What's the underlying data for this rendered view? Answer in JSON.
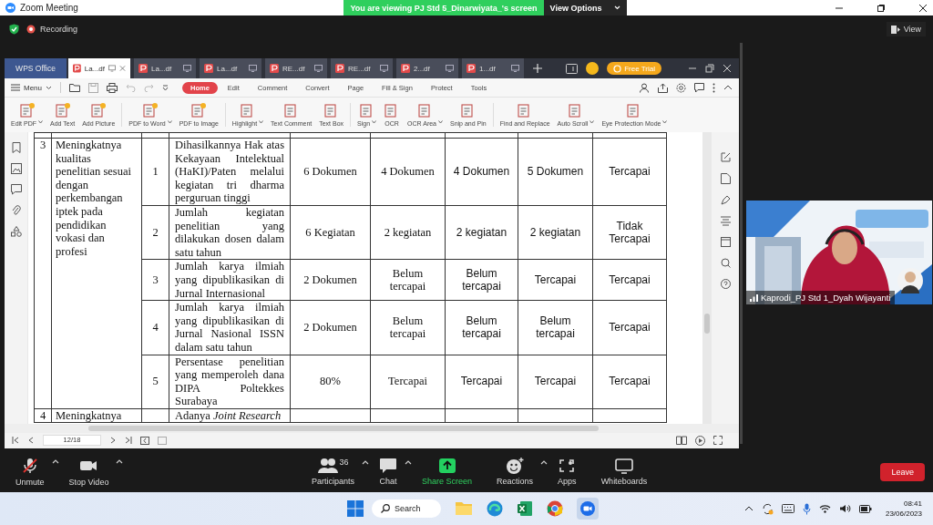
{
  "title_bar": {
    "title": "Zoom Meeting",
    "banner": "You are viewing PJ Std 5_Dinarwiyata_'s screen",
    "view_options": "View Options"
  },
  "meeting": {
    "recording": "Recording",
    "view_button": "View"
  },
  "wps": {
    "app_tab": "WPS Office",
    "tabs": [
      {
        "label": "La...df",
        "selected": true
      },
      {
        "label": "La...df",
        "selected": false
      },
      {
        "label": "La...df",
        "selected": false
      },
      {
        "label": "RE...df",
        "selected": false
      },
      {
        "label": "RE...df",
        "selected": false
      },
      {
        "label": "2...df",
        "selected": false
      },
      {
        "label": "1...df",
        "selected": false
      }
    ],
    "trial_button": "Free Trial",
    "menu": "Menu",
    "ribbon_tabs": [
      {
        "label": "Home",
        "selected": true
      },
      {
        "label": "Edit",
        "selected": false
      },
      {
        "label": "Comment",
        "selected": false
      },
      {
        "label": "Convert",
        "selected": false
      },
      {
        "label": "Page",
        "selected": false
      },
      {
        "label": "Fill & Sign",
        "selected": false
      },
      {
        "label": "Protect",
        "selected": false
      },
      {
        "label": "Tools",
        "selected": false
      }
    ],
    "tools": [
      {
        "label": "Edit PDF",
        "dropdown": true,
        "badge": true,
        "separator_before": false
      },
      {
        "label": "Add Text",
        "dropdown": false,
        "badge": true,
        "separator_before": false
      },
      {
        "label": "Add Picture",
        "dropdown": false,
        "badge": true,
        "separator_before": false
      },
      {
        "label": "PDF to Word",
        "dropdown": true,
        "badge": true,
        "separator_before": true
      },
      {
        "label": "PDF to Image",
        "dropdown": false,
        "badge": true,
        "separator_before": false
      },
      {
        "label": "Highlight",
        "dropdown": true,
        "badge": false,
        "separator_before": true
      },
      {
        "label": "Text Comment",
        "dropdown": false,
        "badge": false,
        "separator_before": false
      },
      {
        "label": "Text Box",
        "dropdown": false,
        "badge": false,
        "separator_before": false
      },
      {
        "label": "Sign",
        "dropdown": true,
        "badge": false,
        "separator_before": true
      },
      {
        "label": "OCR",
        "dropdown": false,
        "badge": false,
        "separator_before": false
      },
      {
        "label": "OCR Area",
        "dropdown": true,
        "badge": false,
        "separator_before": false
      },
      {
        "label": "Snip and Pin",
        "dropdown": false,
        "badge": false,
        "separator_before": false
      },
      {
        "label": "Find and Replace",
        "dropdown": false,
        "badge": false,
        "separator_before": true
      },
      {
        "label": "Auto Scroll",
        "dropdown": true,
        "badge": false,
        "separator_before": false
      },
      {
        "label": "Eye Protection Mode",
        "dropdown": true,
        "badge": false,
        "separator_before": false
      }
    ]
  },
  "document": {
    "goals": [
      {
        "no": "3",
        "objective": "Meningkatnya kualitas penelitian sesuai dengan perkembangan iptek pada pendidikan vokasi dan profesi",
        "items": [
          {
            "index": "1",
            "indicator": "Dihasilkannya Hak atas Kekayaan Intelektual (HaKI)/Paten melalui kegiatan tri dharma perguruan tinggi",
            "values": [
              "6 Dokumen",
              "4 Dokumen",
              "4 Dokumen",
              "5 Dokumen",
              "Tercapai"
            ]
          },
          {
            "index": "2",
            "indicator": "Jumlah kegiatan penelitian yang dilakukan dosen dalam satu tahun",
            "values": [
              "6 Kegiatan",
              "2 kegiatan",
              "2 kegiatan",
              "2 kegiatan",
              "Tidak Tercapai"
            ]
          },
          {
            "index": "3",
            "indicator": "Jumlah karya ilmiah yang dipublikasikan di Jurnal Internasional",
            "values": [
              "2 Dokumen",
              "Belum tercapai",
              "Belum tercapai",
              "Tercapai",
              "Tercapai"
            ]
          },
          {
            "index": "4",
            "indicator": "Jumlah karya ilmiah yang dipublikasikan di Jurnal Nasional ISSN dalam satu tahun",
            "values": [
              "2 Dokumen",
              "Belum tercapai",
              "Belum tercapai",
              "Belum tercapai",
              "Tercapai"
            ]
          },
          {
            "index": "5",
            "indicator": "Persentase penelitian yang memperoleh dana DIPA Poltekkes Surabaya",
            "values": [
              "80%",
              "Tercapai",
              "Tercapai",
              "Tercapai",
              "Tercapai"
            ]
          }
        ]
      },
      {
        "no": "4",
        "objective": "Meningkatnya",
        "items": [
          {
            "indicator": "Adanya *Joint Research*"
          }
        ]
      }
    ]
  },
  "page_nav": {
    "page": "12/18"
  },
  "video": {
    "name": "Kaprodi_PJ Std 1_Dyah Wijayanti"
  },
  "toolbar": [
    {
      "kind": "mic",
      "label": "Unmute",
      "caret": true,
      "muted": true
    },
    {
      "kind": "camera",
      "label": "Stop Video",
      "caret": true
    },
    {
      "kind": "participants",
      "label": "Participants",
      "count": "36",
      "caret": true
    },
    {
      "kind": "chat",
      "label": "Chat",
      "caret": true
    },
    {
      "kind": "share",
      "label": "Share Screen",
      "caret": false
    },
    {
      "kind": "reactions",
      "label": "Reactions",
      "caret": true
    },
    {
      "kind": "apps",
      "label": "Apps",
      "caret": false
    },
    {
      "kind": "whiteboards",
      "label": "Whiteboards",
      "caret": false
    }
  ],
  "leave": "Leave",
  "taskbar": {
    "search": "Search",
    "time": "08:41",
    "date": "23/06/2023"
  }
}
